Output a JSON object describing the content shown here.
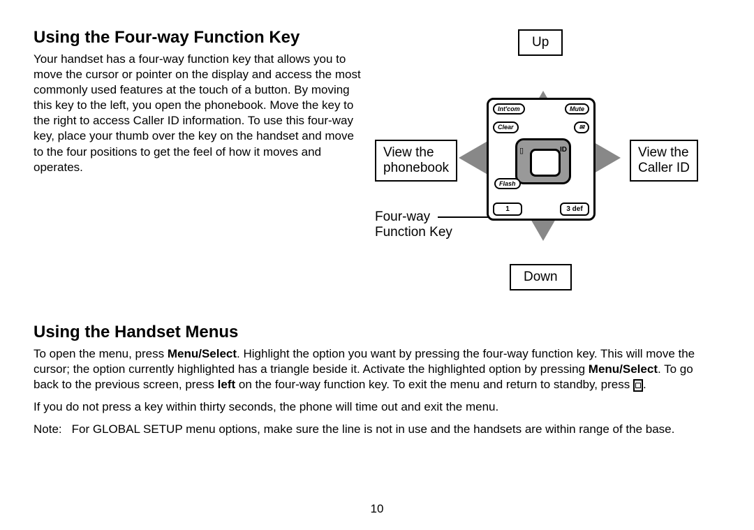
{
  "section1": {
    "heading": "Using the Four-way Function Key",
    "paragraph": "Your handset has a four-way function key that allows you to move the cursor or pointer on the display and access the most commonly used features at the touch of a button. By moving this key to the left, you open the phonebook. Move the key to the right to access Caller ID information. To use this four-way key, place your thumb over the key on the handset and move to the four positions to get the feel of how it moves and operates."
  },
  "diagram": {
    "up": "Up",
    "down": "Down",
    "left_line1": "View the",
    "left_line2": "phonebook",
    "right_line1": "View the",
    "right_line2": "Caller ID",
    "fwfk_line1": "Four-way",
    "fwfk_line2": "Function Key",
    "btn_intcom": "Int'com",
    "btn_mute": "Mute",
    "btn_clear": "Clear",
    "btn_flash": "Flash",
    "key_1": "1",
    "key_3": "3 def"
  },
  "section2": {
    "heading": "Using the Handset Menus",
    "p1_a": "To open the menu, press ",
    "p1_b": "Menu/Select",
    "p1_c": ". Highlight the option you want by pressing the four-way function key. This will move the cursor; the option currently highlighted has a triangle beside it. Activate the highlighted option by pressing ",
    "p1_d": "Menu/Select",
    "p1_e": ". To go back to the previous screen, press ",
    "p1_f": "left",
    "p1_g": " on the four-way function key. To exit the menu and return to standby, press ",
    "p1_h": ".",
    "p2": "If you do not press a key within thirty seconds, the phone will time out and exit the menu.",
    "note_label": "Note:",
    "note_text": "For GLOBAL SETUP menu options, make sure the line is not in use and the handsets are within range of the base."
  },
  "page_number": "10"
}
